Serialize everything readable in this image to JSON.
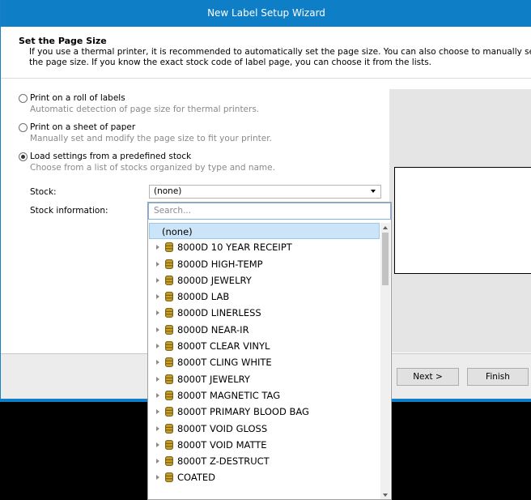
{
  "window": {
    "title": "New Label Setup Wizard"
  },
  "header": {
    "title": "Set the Page Size",
    "description": "If you use a thermal printer, it is recommended to automatically set the page size. You can also choose to manually set the page size. If you know the exact stock code of label page, you can choose it from the lists."
  },
  "options": [
    {
      "title": "Print on a roll of labels",
      "desc": "Automatic detection of page size for thermal printers.",
      "selected": false
    },
    {
      "title": "Print on a sheet of paper",
      "desc": "Manually set and modify the page size to fit your printer.",
      "selected": false
    },
    {
      "title": "Load settings from a predefined stock",
      "desc": "Choose from a list of stocks organized by type and name.",
      "selected": true
    }
  ],
  "stock": {
    "label": "Stock:",
    "value": "(none)",
    "info_label": "Stock information:"
  },
  "dropdown": {
    "search_placeholder": "Search...",
    "selected_item": "(none)",
    "items": [
      "8000D 10 YEAR RECEIPT",
      "8000D HIGH-TEMP",
      "8000D JEWELRY",
      "8000D LAB",
      "8000D LINERLESS",
      "8000D NEAR-IR",
      "8000T CLEAR VINYL",
      "8000T CLING WHITE",
      "8000T JEWELRY",
      "8000T MAGNETIC TAG",
      "8000T PRIMARY BLOOD BAG",
      "8000T VOID GLOSS",
      "8000T VOID MATTE",
      "8000T Z-DESTRUCT",
      "COATED"
    ]
  },
  "buttons": {
    "next": "Next >",
    "finish": "Finish"
  },
  "colors": {
    "accent": "#0e7fc7",
    "selection": "#cce4f7",
    "stock_icon": "#c9a227"
  }
}
